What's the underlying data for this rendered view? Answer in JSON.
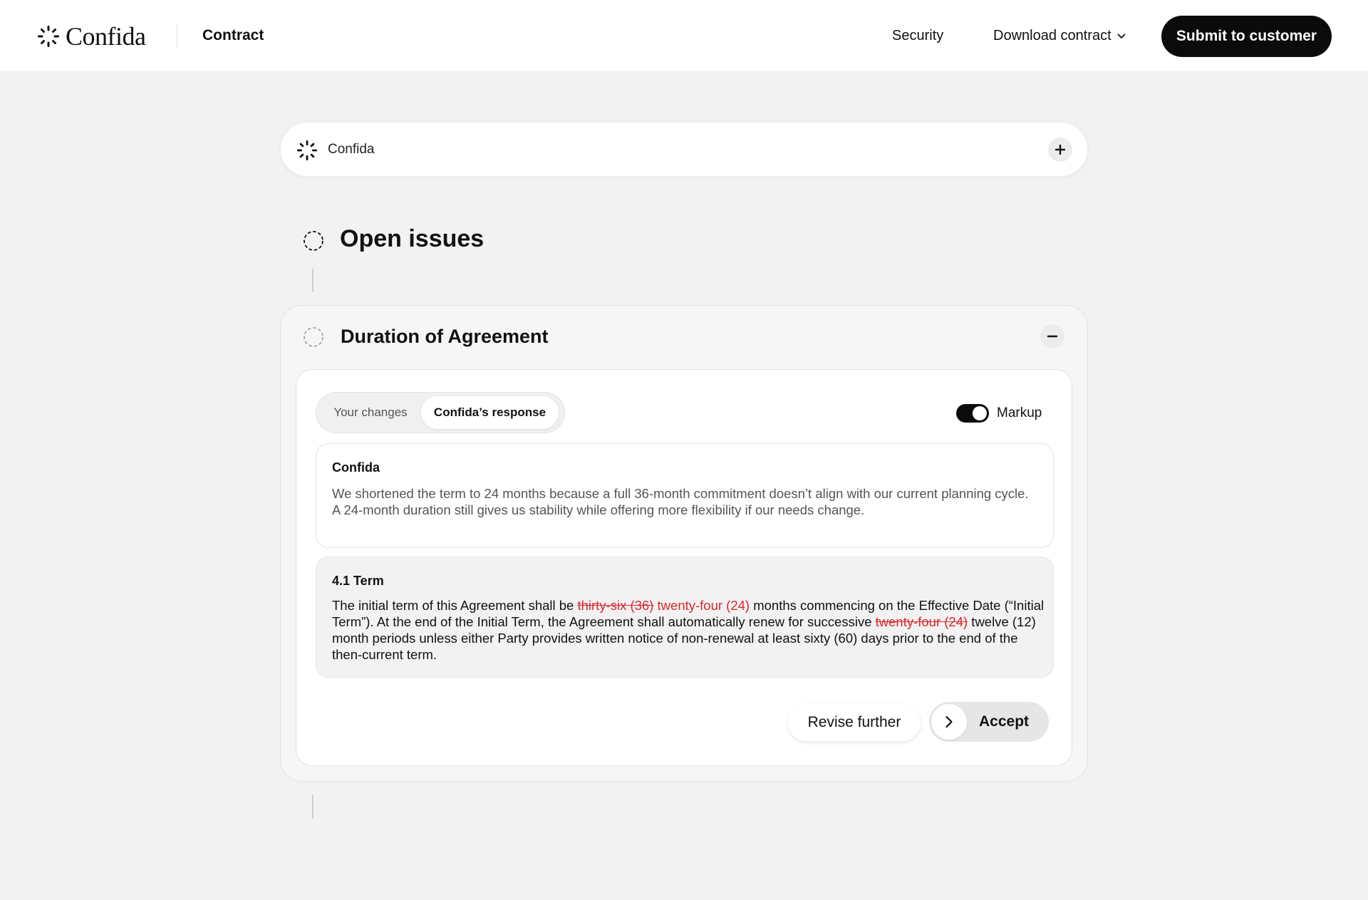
{
  "header": {
    "brand": "Confida",
    "section": "Contract",
    "nav": {
      "security": "Security",
      "download": "Download contract"
    },
    "submit_label": "Submit to customer"
  },
  "assistant_bar": {
    "label": "Confida",
    "icon": "sparkle-spinner-icon"
  },
  "open_issues": {
    "title": "Open issues"
  },
  "issue": {
    "title": "Duration of Agreement",
    "tabs": [
      {
        "label": "Your changes",
        "active": false
      },
      {
        "label": "Confida’s response",
        "active": true
      }
    ],
    "markup": {
      "label": "Markup",
      "on": true
    },
    "comment": {
      "author": "Confida",
      "text": "We shortened the term to 24 months because a full 36-month commitment doesn’t align with our current planning cycle. A 24-month duration still gives us stability while offering more flexibility if our needs change."
    },
    "clause": {
      "heading": "4.1 Term",
      "segments": [
        {
          "type": "text",
          "text": "The initial term of this Agreement shall be "
        },
        {
          "type": "del",
          "text": "thirty-six (36)"
        },
        {
          "type": "text",
          "text": " "
        },
        {
          "type": "ins",
          "text": "twenty-four (24)"
        },
        {
          "type": "text",
          "text": " months commencing on the Effective Date (“Initial Term”). At the end of the Initial Term, the Agreement shall automatically renew for successive "
        },
        {
          "type": "del",
          "text": "twenty-four (24)"
        },
        {
          "type": "text",
          "text": " twelve (12) month periods unless either Party provides written notice of non-renewal at least sixty (60) days prior to the end of the then-current term."
        }
      ]
    },
    "actions": {
      "revise": "Revise further",
      "accept": "Accept"
    }
  },
  "colors": {
    "accent_dark": "#0b0b0b",
    "markup_red": "#d9292e",
    "background": "#f2f2f2"
  }
}
